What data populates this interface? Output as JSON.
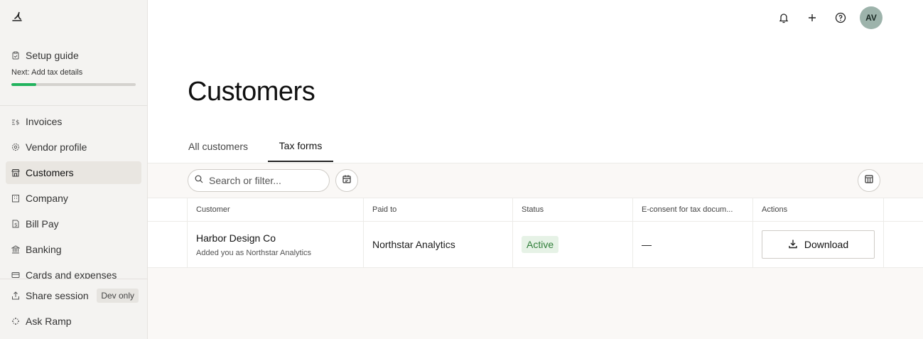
{
  "sidebar": {
    "logo_icon": "ramp-logo-icon",
    "setup": {
      "label": "Setup guide",
      "next": "Next: Add tax details",
      "progress_fraction": 0.2
    },
    "items": [
      {
        "label": "Invoices",
        "icon": "invoice-icon"
      },
      {
        "label": "Vendor profile",
        "icon": "gear-icon"
      },
      {
        "label": "Customers",
        "icon": "store-icon",
        "active": true
      },
      {
        "label": "Company",
        "icon": "building-icon"
      },
      {
        "label": "Bill Pay",
        "icon": "bill-icon"
      },
      {
        "label": "Banking",
        "icon": "bank-icon"
      },
      {
        "label": "Cards and expenses",
        "icon": "card-icon"
      }
    ],
    "bottom": {
      "share_label": "Share session",
      "dev_badge": "Dev only",
      "ask_label": "Ask Ramp"
    }
  },
  "topbar": {
    "avatar_initials": "AV"
  },
  "page": {
    "title": "Customers",
    "tabs": [
      {
        "label": "All customers"
      },
      {
        "label": "Tax forms",
        "active": true
      }
    ]
  },
  "toolbar": {
    "search_placeholder": "Search or filter..."
  },
  "table": {
    "headers": [
      "Customer",
      "Paid to",
      "Status",
      "E-consent for tax docum...",
      "Actions"
    ],
    "rows": [
      {
        "customer": "Harbor Design Co",
        "customer_sub": "Added you as Northstar Analytics",
        "paid_to": "Northstar Analytics",
        "status": "Active",
        "econsent": "—",
        "action": "Download"
      }
    ]
  },
  "colors": {
    "accent_green": "#22b35e",
    "status_green_bg": "#e6f2e6",
    "status_green_text": "#2f7d38",
    "avatar_bg": "#9db3ab"
  }
}
